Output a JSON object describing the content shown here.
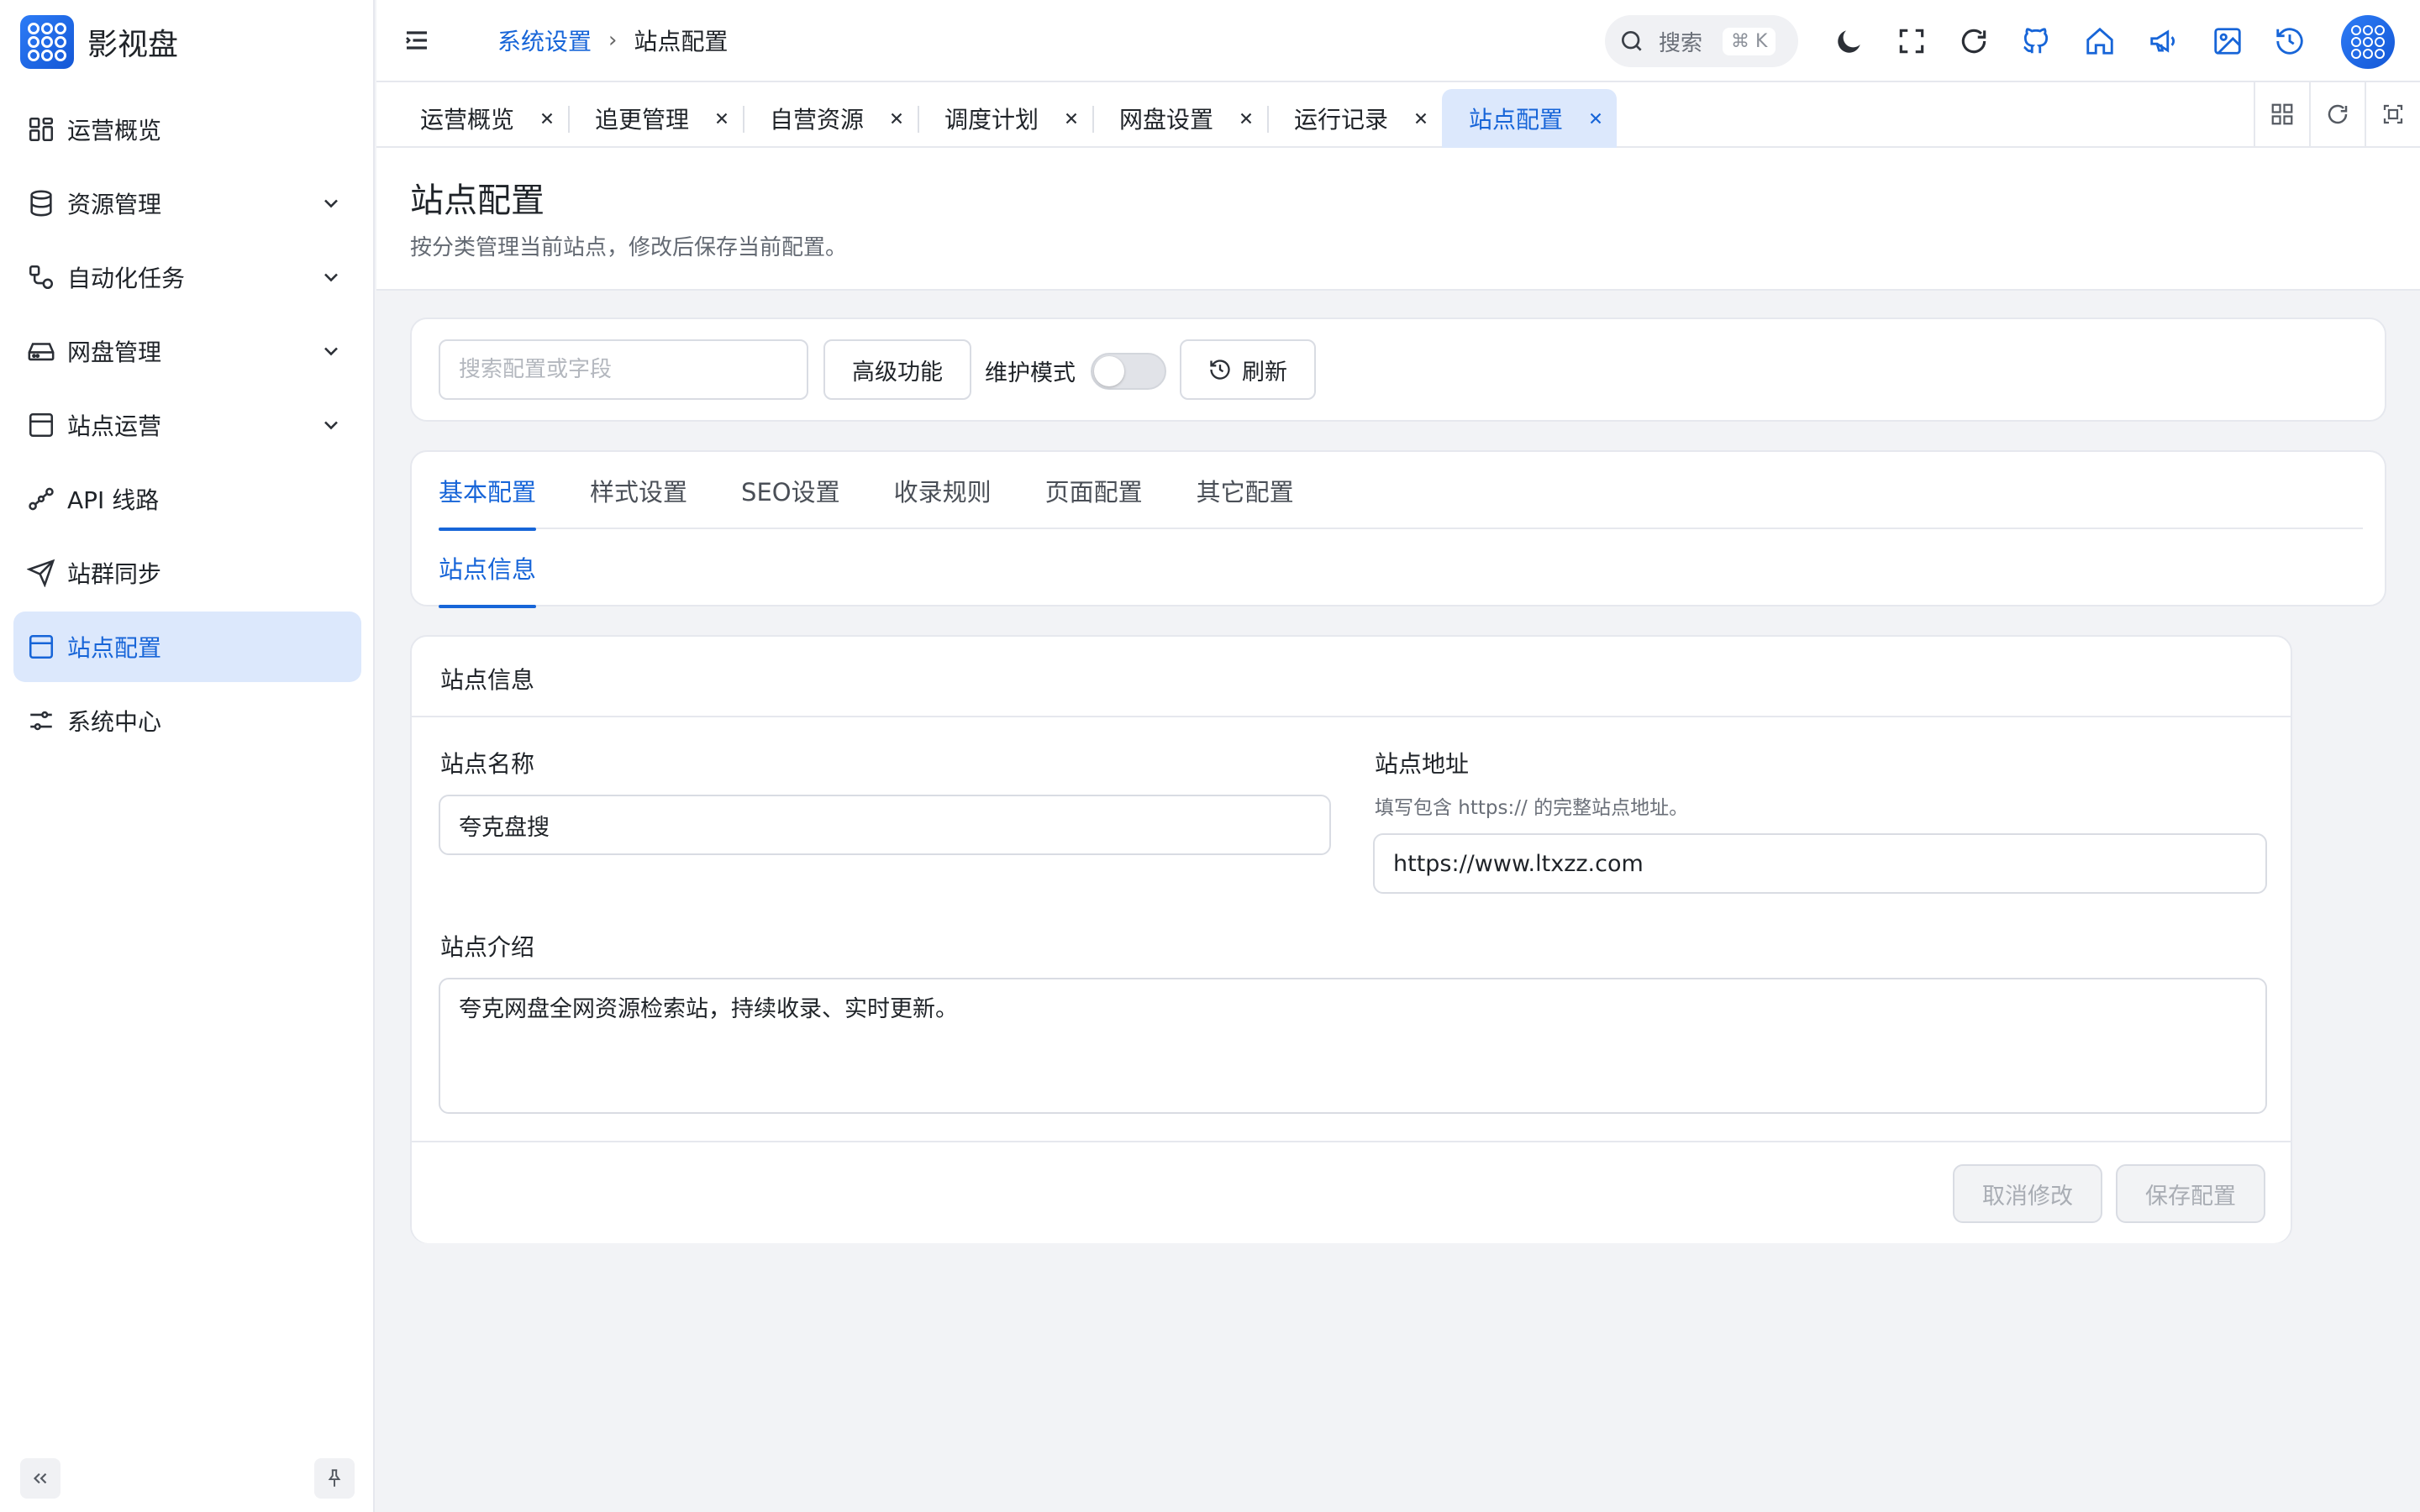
{
  "app": {
    "name": "影视盘"
  },
  "sidebar": {
    "items": [
      {
        "label": "运营概览",
        "icon": "dashboard-icon",
        "has_children": false,
        "active": false
      },
      {
        "label": "资源管理",
        "icon": "database-icon",
        "has_children": true,
        "active": false
      },
      {
        "label": "自动化任务",
        "icon": "workflow-icon",
        "has_children": true,
        "active": false
      },
      {
        "label": "网盘管理",
        "icon": "drive-icon",
        "has_children": true,
        "active": false
      },
      {
        "label": "站点运营",
        "icon": "browser-icon",
        "has_children": true,
        "active": false
      },
      {
        "label": "API 线路",
        "icon": "route-icon",
        "has_children": false,
        "active": false
      },
      {
        "label": "站群同步",
        "icon": "send-icon",
        "has_children": false,
        "active": false
      },
      {
        "label": "站点配置",
        "icon": "window-icon",
        "has_children": false,
        "active": true
      },
      {
        "label": "系统中心",
        "icon": "settings-sliders-icon",
        "has_children": false,
        "active": false
      }
    ]
  },
  "header": {
    "breadcrumb": [
      "系统设置",
      "站点配置"
    ],
    "search": {
      "label": "搜索",
      "shortcut": "⌘ K"
    },
    "icons": [
      "moon-icon",
      "fullscreen-icon",
      "refresh-icon",
      "github-icon",
      "home-icon",
      "megaphone-icon",
      "image-icon",
      "history-icon"
    ]
  },
  "tabs": [
    {
      "label": "运营概览",
      "active": false
    },
    {
      "label": "追更管理",
      "active": false
    },
    {
      "label": "自营资源",
      "active": false
    },
    {
      "label": "调度计划",
      "active": false
    },
    {
      "label": "网盘设置",
      "active": false
    },
    {
      "label": "运行记录",
      "active": false
    },
    {
      "label": "站点配置",
      "active": true
    }
  ],
  "page": {
    "title": "站点配置",
    "description": "按分类管理当前站点，修改后保存当前配置。"
  },
  "toolbar": {
    "search_placeholder": "搜索配置或字段",
    "advanced_label": "高级功能",
    "maintenance_label": "维护模式",
    "maintenance_on": false,
    "refresh_label": "刷新"
  },
  "config_tabs": {
    "main": [
      "基本配置",
      "样式设置",
      "SEO设置",
      "收录规则",
      "页面配置",
      "其它配置"
    ],
    "main_active": 0,
    "sub": [
      "站点信息"
    ],
    "sub_active": 0
  },
  "form": {
    "section_title": "站点信息",
    "site_name": {
      "label": "站点名称",
      "value": "夸克盘搜"
    },
    "site_url": {
      "label": "站点地址",
      "hint": "填写包含 https:// 的完整站点地址。",
      "value": "https://www.ltxzz.com"
    },
    "site_intro": {
      "label": "站点介绍",
      "value": "夸克网盘全网资源检索站，持续收录、实时更新。"
    },
    "cancel_label": "取消修改",
    "save_label": "保存配置"
  },
  "colors": {
    "accent": "#1765d8",
    "active_bg": "#dce8fc",
    "page_bg": "#f2f3f6"
  }
}
